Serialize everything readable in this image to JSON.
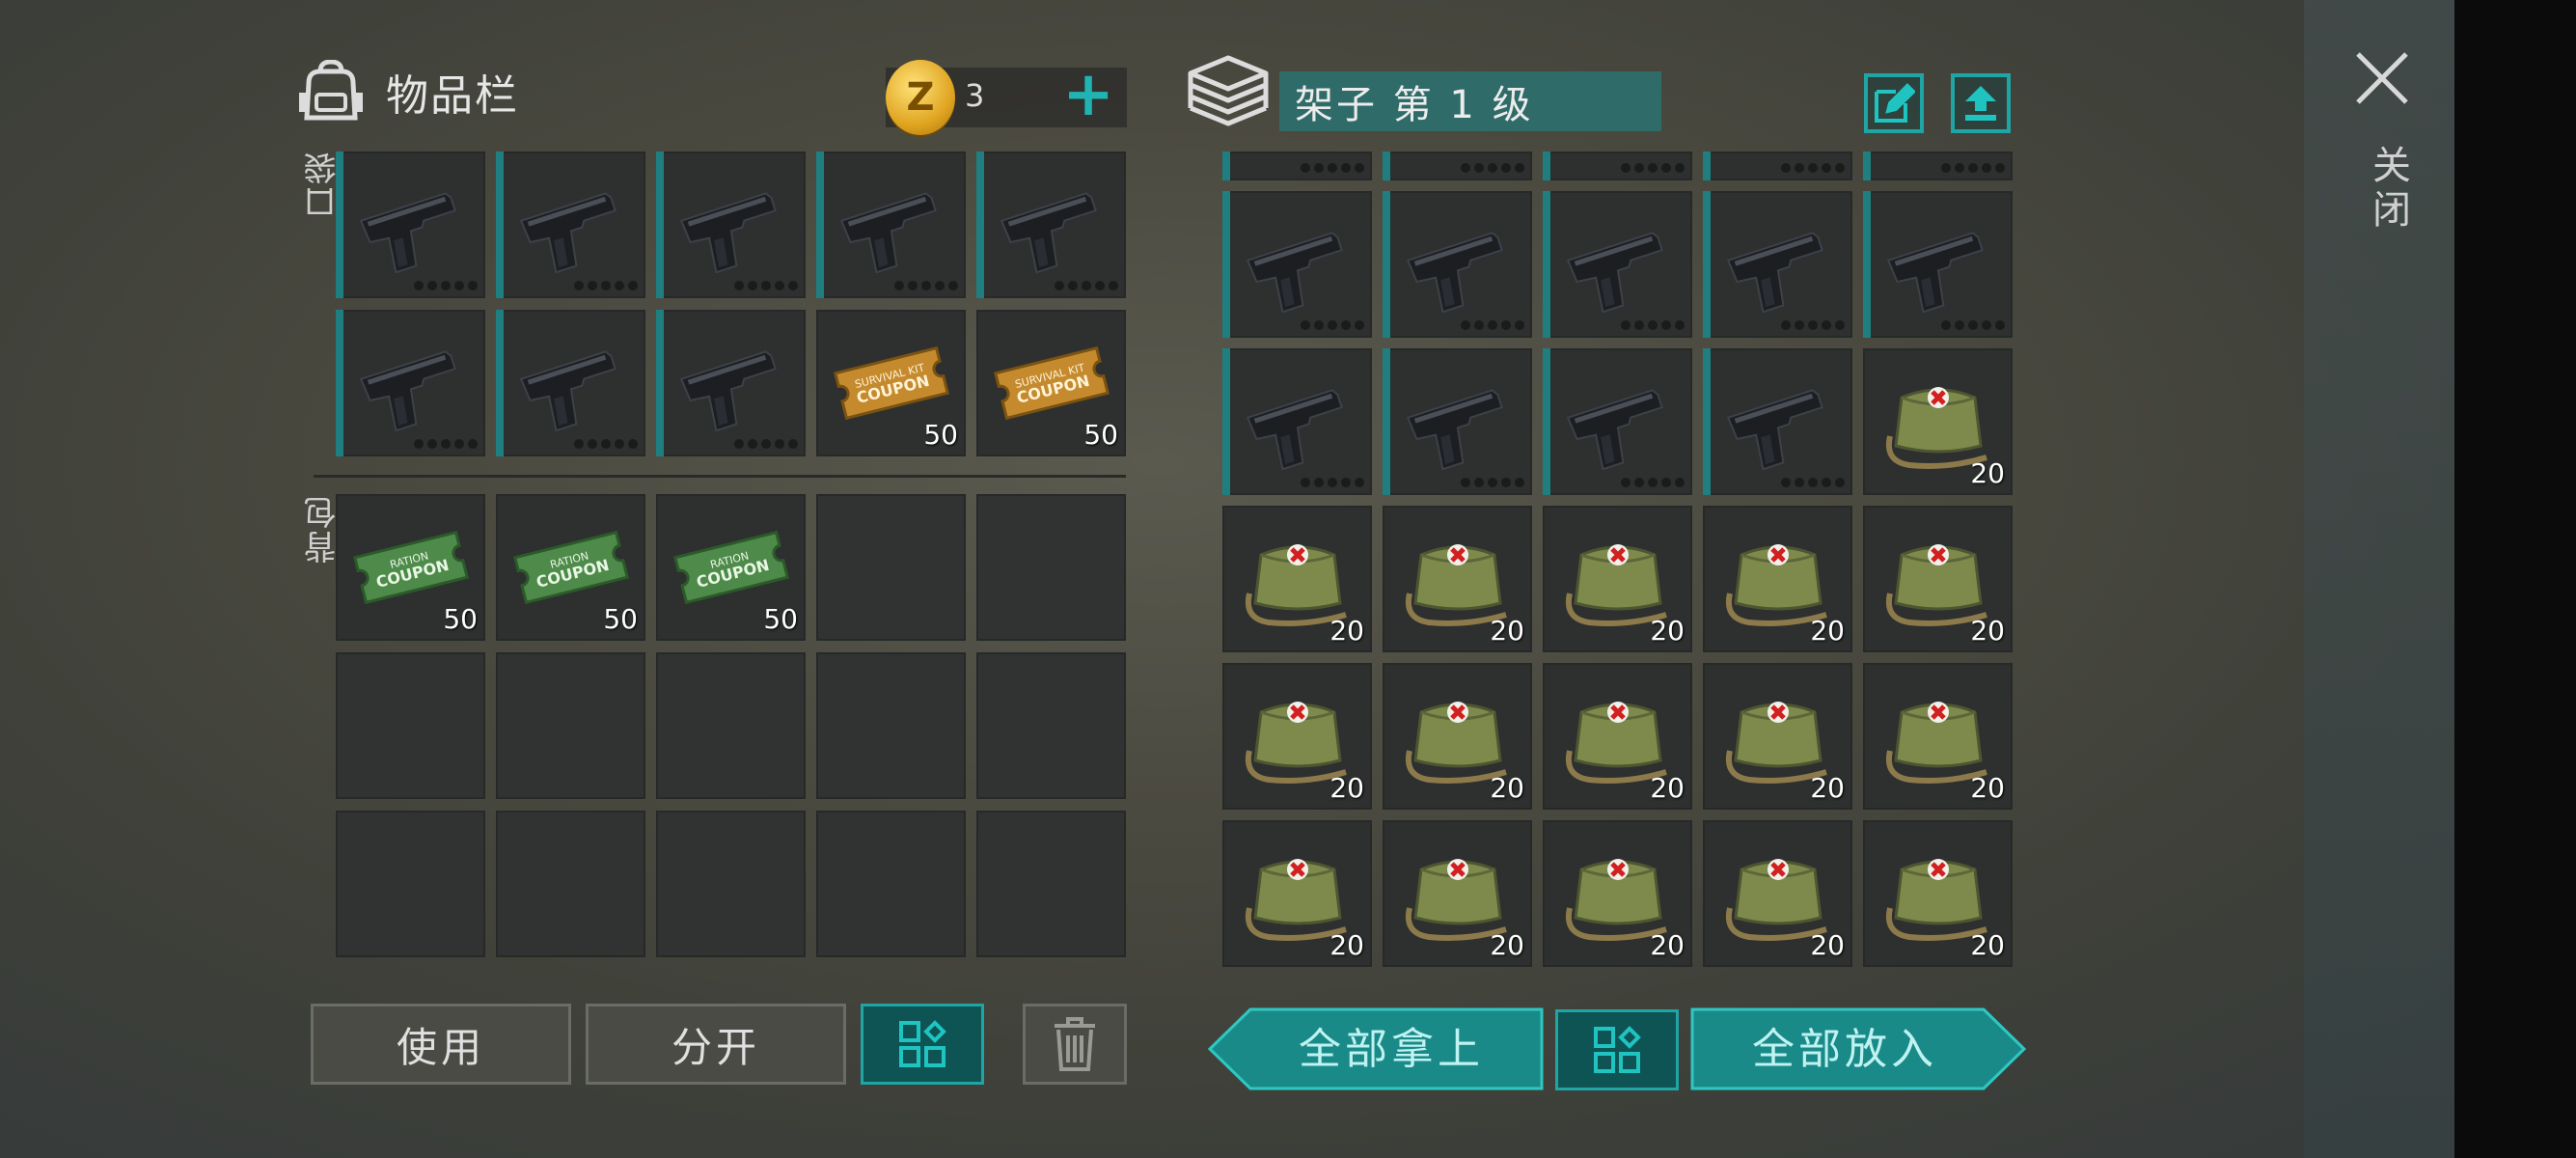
{
  "inventory": {
    "title": "物品栏",
    "coins": "3",
    "coin_symbol": "Z",
    "pocket_label": "口袋",
    "backpack_label": "背包",
    "pocket_slots": [
      {
        "type": "pistol"
      },
      {
        "type": "pistol"
      },
      {
        "type": "pistol"
      },
      {
        "type": "pistol"
      },
      {
        "type": "pistol"
      },
      {
        "type": "pistol"
      },
      {
        "type": "pistol"
      },
      {
        "type": "pistol"
      },
      {
        "type": "survival-coupon",
        "qty": "50"
      },
      {
        "type": "survival-coupon",
        "qty": "50"
      }
    ],
    "backpack_slots": [
      {
        "type": "ration-coupon",
        "qty": "50"
      },
      {
        "type": "ration-coupon",
        "qty": "50"
      },
      {
        "type": "ration-coupon",
        "qty": "50"
      },
      {
        "type": "empty"
      },
      {
        "type": "empty"
      },
      {
        "type": "empty"
      },
      {
        "type": "empty"
      },
      {
        "type": "empty"
      },
      {
        "type": "empty"
      },
      {
        "type": "empty"
      },
      {
        "type": "empty"
      },
      {
        "type": "empty"
      },
      {
        "type": "empty"
      },
      {
        "type": "empty"
      },
      {
        "type": "empty"
      }
    ],
    "buttons": {
      "use": "使用",
      "split": "分开"
    }
  },
  "shelf": {
    "title": "架子 第 1 级",
    "slots": [
      {
        "type": "pistol"
      },
      {
        "type": "pistol"
      },
      {
        "type": "pistol"
      },
      {
        "type": "pistol"
      },
      {
        "type": "pistol"
      },
      {
        "type": "pistol"
      },
      {
        "type": "pistol"
      },
      {
        "type": "pistol"
      },
      {
        "type": "pistol"
      },
      {
        "type": "medkit",
        "qty": "20"
      },
      {
        "type": "medkit",
        "qty": "20"
      },
      {
        "type": "medkit",
        "qty": "20"
      },
      {
        "type": "medkit",
        "qty": "20"
      },
      {
        "type": "medkit",
        "qty": "20"
      },
      {
        "type": "medkit",
        "qty": "20"
      },
      {
        "type": "medkit",
        "qty": "20"
      },
      {
        "type": "medkit",
        "qty": "20"
      },
      {
        "type": "medkit",
        "qty": "20"
      },
      {
        "type": "medkit",
        "qty": "20"
      },
      {
        "type": "medkit",
        "qty": "20"
      },
      {
        "type": "medkit",
        "qty": "20"
      },
      {
        "type": "medkit",
        "qty": "20"
      },
      {
        "type": "medkit",
        "qty": "20"
      },
      {
        "type": "medkit",
        "qty": "20"
      },
      {
        "type": "medkit",
        "qty": "20"
      }
    ],
    "buttons": {
      "take_all": "全部拿上",
      "put_all": "全部放入"
    }
  },
  "close_label": "关闭",
  "icons": {
    "backpack": "backpack-icon",
    "coin": "coin-icon",
    "add": "plus-icon",
    "shelf": "shelf-icon",
    "rename": "edit-icon",
    "upgrade": "upgrade-icon",
    "sort": "sort-grid-icon",
    "trash": "trash-icon",
    "close": "close-icon"
  },
  "colors": {
    "accent": "#1fa5a3",
    "weapon_bar": "#1f7f80",
    "slot_bg": "#2d302f"
  }
}
